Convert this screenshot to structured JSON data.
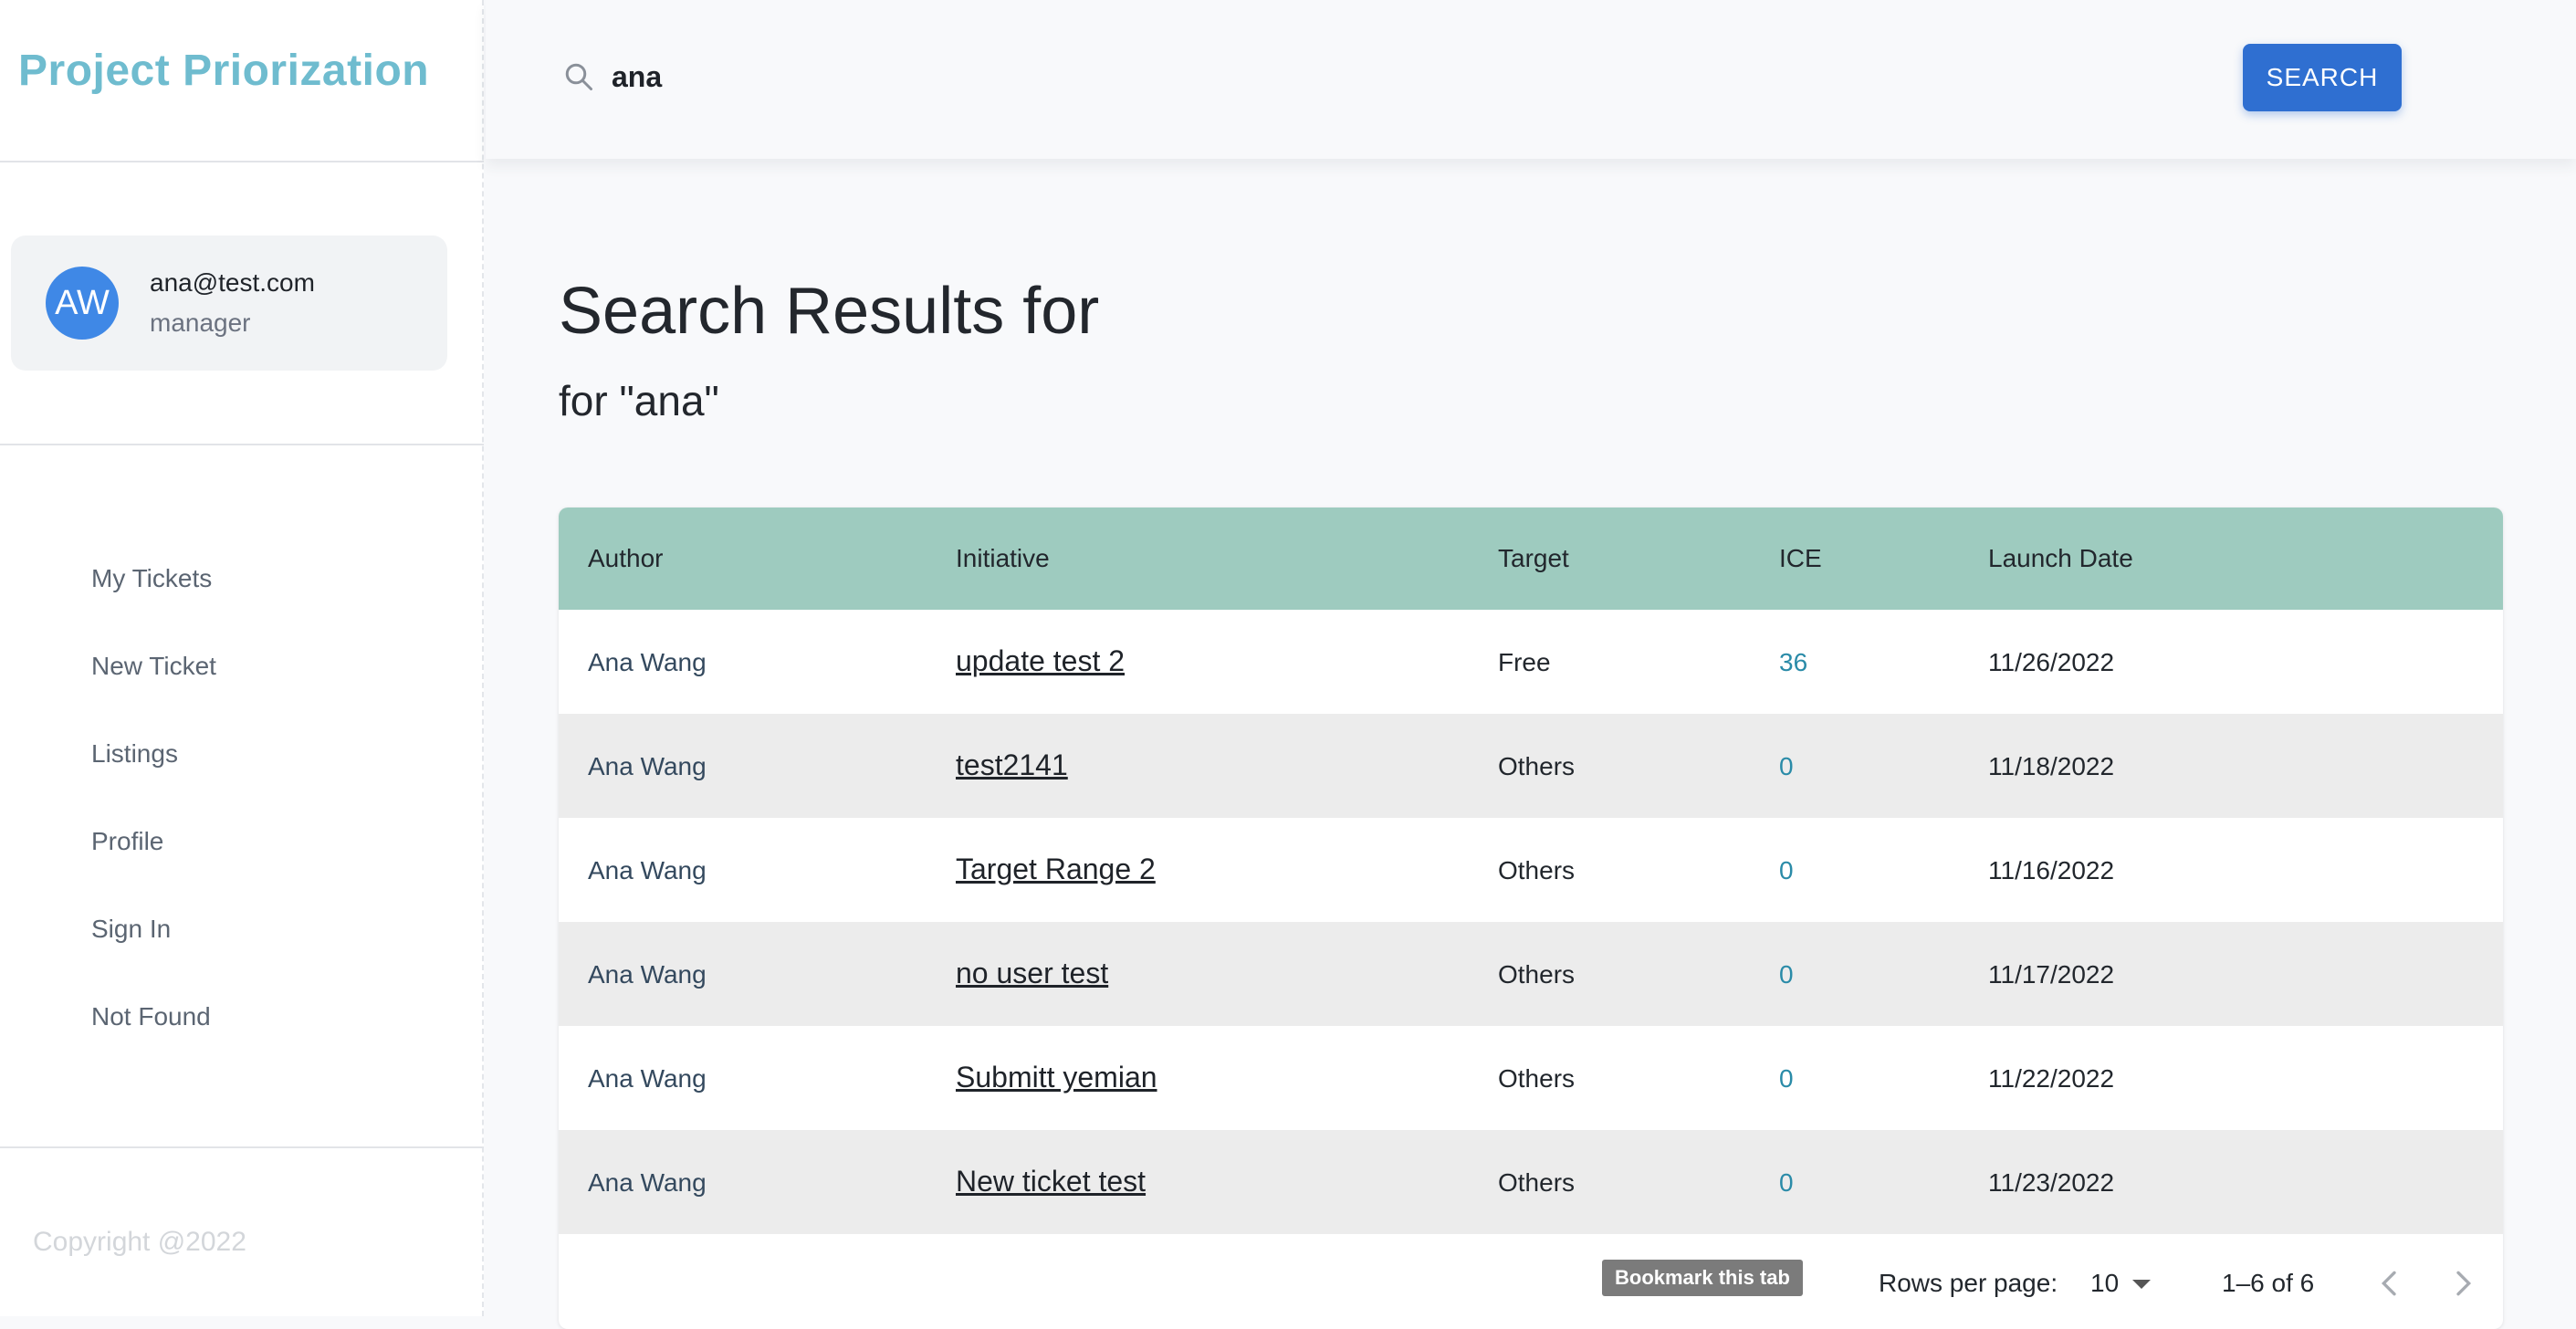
{
  "sidebar": {
    "brand": "Project Priorization",
    "user": {
      "initials": "AW",
      "email": "ana@test.com",
      "role": "manager"
    },
    "nav": [
      "My Tickets",
      "New Ticket",
      "Listings",
      "Profile",
      "Sign In",
      "Not Found"
    ],
    "copyright": "Copyright @2022"
  },
  "topbar": {
    "search_value": "ana",
    "search_button": "SEARCH",
    "accent_color": "#2f6fd1"
  },
  "main": {
    "title": "Search Results for",
    "subtitle": "for \"ana\""
  },
  "table": {
    "header_color": "#9ecbbf",
    "columns": [
      "Author",
      "Initiative",
      "Target",
      "ICE",
      "Launch Date"
    ],
    "rows": [
      {
        "author": "Ana Wang",
        "initiative": "update test 2",
        "target": "Free",
        "ice": "36",
        "launch": "11/26/2022"
      },
      {
        "author": "Ana Wang",
        "initiative": "test2141",
        "target": "Others",
        "ice": "0",
        "launch": "11/18/2022"
      },
      {
        "author": "Ana Wang",
        "initiative": "Target Range 2",
        "target": "Others",
        "ice": "0",
        "launch": "11/16/2022"
      },
      {
        "author": "Ana Wang",
        "initiative": "no user test",
        "target": "Others",
        "ice": "0",
        "launch": "11/17/2022"
      },
      {
        "author": "Ana Wang",
        "initiative": "Submitt yemian",
        "target": "Others",
        "ice": "0",
        "launch": "11/22/2022"
      },
      {
        "author": "Ana Wang",
        "initiative": "New ticket test",
        "target": "Others",
        "ice": "0",
        "launch": "11/23/2022"
      }
    ]
  },
  "pagination": {
    "tooltip": "Bookmark this tab",
    "rows_per_page_label": "Rows per page:",
    "rows_per_page_value": "10",
    "range": "1–6 of 6",
    "prev_icon": "chevron-left-icon",
    "next_icon": "chevron-right-icon"
  }
}
